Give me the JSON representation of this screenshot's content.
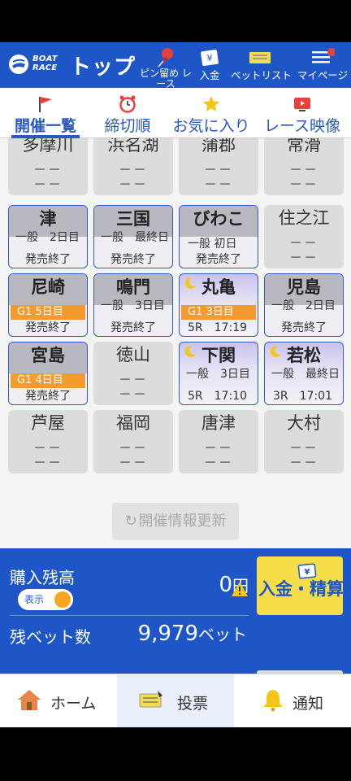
{
  "header": {
    "logo_text_1": "BOAT",
    "logo_text_2": "RACE",
    "title": "トップ",
    "nav": [
      {
        "label": "ピン留め レース",
        "icon": "pin-icon"
      },
      {
        "label": "入金",
        "icon": "deposit-card-icon"
      },
      {
        "label": "ベットリスト",
        "icon": "ticket-list-icon"
      },
      {
        "label": "マイページ",
        "icon": "menu-icon"
      }
    ]
  },
  "tabs": [
    {
      "label": "開催一覧",
      "icon": "flag-icon",
      "active": true
    },
    {
      "label": "締切順",
      "icon": "alarm-clock-icon"
    },
    {
      "label": "お気に入り",
      "icon": "star-icon"
    },
    {
      "label": "レース映像",
      "icon": "video-icon"
    }
  ],
  "venues": [
    {
      "name": "多摩川",
      "state": "closed",
      "line1": "－－",
      "line2": "－－"
    },
    {
      "name": "浜名湖",
      "state": "closed",
      "line1": "－－",
      "line2": "－－"
    },
    {
      "name": "蒲郡",
      "state": "closed",
      "line1": "－－",
      "line2": "－－"
    },
    {
      "name": "常滑",
      "state": "closed",
      "line1": "－－",
      "line2": "－－"
    },
    {
      "name": "津",
      "state": "open",
      "grade": "一般",
      "day": "2日目",
      "status": "発売終了"
    },
    {
      "name": "三国",
      "state": "open",
      "grade": "一般",
      "day": "最終日",
      "status": "発売終了"
    },
    {
      "name": "びわこ",
      "state": "open",
      "grade": "一般",
      "day": "初日",
      "status": "発売終了"
    },
    {
      "name": "住之江",
      "state": "closed",
      "line1": "－－",
      "line2": "－－"
    },
    {
      "name": "尼崎",
      "state": "open",
      "g1": "G1 5日目",
      "status": "発売終了"
    },
    {
      "name": "鳴門",
      "state": "open",
      "grade": "一般",
      "day": "3日目",
      "status": "発売終了"
    },
    {
      "name": "丸亀",
      "state": "night",
      "g1": "G1 3日目",
      "race": "5R",
      "time": "17:19"
    },
    {
      "name": "児島",
      "state": "open",
      "grade": "一般",
      "day": "2日目",
      "status": "発売終了"
    },
    {
      "name": "宮島",
      "state": "open",
      "g1": "G1 4日目",
      "status": "発売終了"
    },
    {
      "name": "徳山",
      "state": "closed",
      "line1": "－－",
      "line2": "－－"
    },
    {
      "name": "下関",
      "state": "night",
      "grade": "一般",
      "day": "3日目",
      "race": "5R",
      "time": "17:10"
    },
    {
      "name": "若松",
      "state": "night",
      "grade": "一般",
      "day": "最終日",
      "race": "3R",
      "time": "17:01"
    },
    {
      "name": "芦屋",
      "state": "closed",
      "line1": "－－",
      "line2": "－－"
    },
    {
      "name": "福岡",
      "state": "closed",
      "line1": "－－",
      "line2": "－－"
    },
    {
      "name": "唐津",
      "state": "closed",
      "line1": "－－",
      "line2": "－－"
    },
    {
      "name": "大村",
      "state": "closed",
      "line1": "－－",
      "line2": "－－"
    }
  ],
  "refresh_label": "開催情報更新",
  "wallet": {
    "balance_label": "購入残高",
    "toggle_label": "表示",
    "balance_value": "0",
    "balance_unit": "円",
    "bets_label": "残ベット数",
    "bets_value": "9,979",
    "bets_unit": "ベット",
    "deposit_label": "入金・精算"
  },
  "bottom_nav": [
    {
      "label": "ホーム",
      "icon": "home-icon"
    },
    {
      "label": "投票",
      "icon": "ticket-icon",
      "active": true
    },
    {
      "label": "通知",
      "icon": "bell-icon"
    }
  ],
  "colors": {
    "primary": "#1e56c8",
    "accent": "#f6a623",
    "g1": "#f39b2c",
    "night": "#c9c3ee"
  }
}
